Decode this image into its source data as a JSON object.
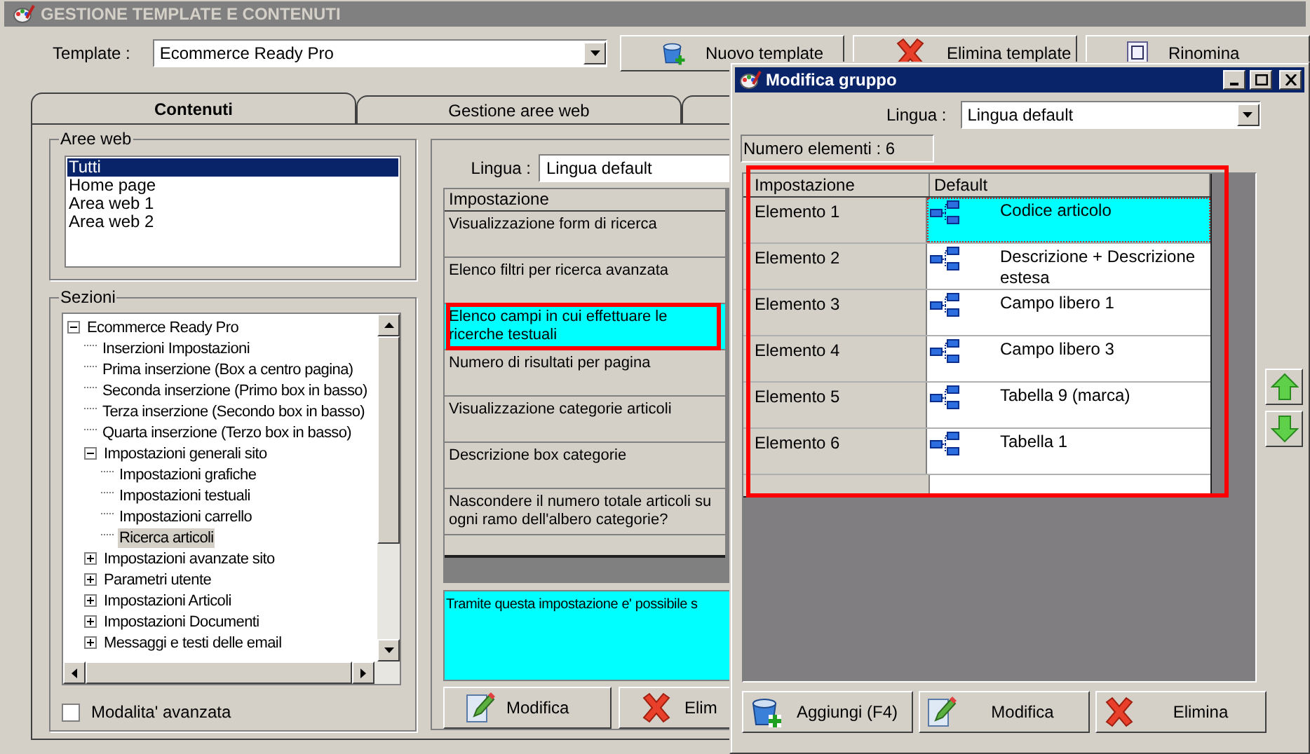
{
  "window": {
    "title": "GESTIONE TEMPLATE E CONTENUTI"
  },
  "template": {
    "label": "Template :",
    "value": "Ecommerce Ready Pro"
  },
  "toolbar": [
    {
      "label": "Nuovo template",
      "kind": "new"
    },
    {
      "label": "Elimina template",
      "kind": "delete"
    },
    {
      "label": "Rinomina",
      "kind": "rename"
    }
  ],
  "tabs": [
    {
      "label": "Contenuti",
      "selected": true
    },
    {
      "label": "Gestione aree web",
      "selected": false
    },
    {
      "selected": false
    }
  ],
  "aree_web": {
    "title": "Aree web",
    "items": [
      {
        "label": "Tutti",
        "selected": true
      },
      {
        "label": "Home page",
        "selected": false
      },
      {
        "label": "Area web 1",
        "selected": false
      },
      {
        "label": "Area web 2",
        "selected": false
      }
    ]
  },
  "sezioni": {
    "title": "Sezioni",
    "tree": [
      {
        "label": "Ecommerce Ready Pro",
        "selected": false,
        "expanded": true,
        "children": [
          {
            "label": "Inserzioni Impostazioni",
            "selected": false
          },
          {
            "label": "Prima inserzione (Box a centro pagina)",
            "selected": false
          },
          {
            "label": "Seconda inserzione (Primo box in basso)",
            "selected": false
          },
          {
            "label": "Terza inserzione (Secondo box in basso)",
            "selected": false
          },
          {
            "label": "Quarta inserzione (Terzo box in basso)",
            "selected": false
          },
          {
            "label": "Impostazioni generali sito",
            "selected": false,
            "expanded": true,
            "children": [
              {
                "label": "Impostazioni grafiche",
                "selected": false
              },
              {
                "label": "Impostazioni testuali",
                "selected": false
              },
              {
                "label": "Impostazioni carrello",
                "selected": false
              },
              {
                "label": "Ricerca articoli",
                "selected": true
              }
            ]
          },
          {
            "label": "Impostazioni avanzate sito",
            "selected": false,
            "expanded": false
          },
          {
            "label": "Parametri utente",
            "selected": false,
            "expanded": false
          },
          {
            "label": "Impostazioni Articoli",
            "selected": false,
            "expanded": false
          },
          {
            "label": "Impostazioni Documenti",
            "selected": false,
            "expanded": false
          },
          {
            "label": "Messaggi e testi delle email",
            "selected": false,
            "expanded": false
          }
        ]
      }
    ]
  },
  "advanced_mode": {
    "label": "Modalita' avanzata",
    "checked": false
  },
  "settings": {
    "lingua_label": "Lingua :",
    "lingua": "Lingua default",
    "column": "Impostazione",
    "rows": [
      {
        "label": "Visualizzazione form di ricerca",
        "selected": false,
        "highlighted": false
      },
      {
        "label": "Elenco filtri per ricerca avanzata",
        "selected": false,
        "highlighted": false
      },
      {
        "label": "Elenco campi in cui effettuare le ricerche testuali",
        "selected": true,
        "highlighted": true
      },
      {
        "label": "Numero di risultati per pagina",
        "selected": false,
        "highlighted": false
      },
      {
        "label": "Visualizzazione categorie articoli",
        "selected": false,
        "highlighted": false
      },
      {
        "label": "Descrizione box categorie",
        "selected": false,
        "highlighted": false
      },
      {
        "label": "Nascondere il numero totale articoli su ogni ramo dell'albero categorie?",
        "selected": false,
        "highlighted": false
      }
    ],
    "description": "Tramite questa impostazione e' possibile s",
    "buttons": [
      {
        "label": "Modifica",
        "kind": "edit"
      },
      {
        "label": "Elim",
        "kind": "delete"
      }
    ]
  },
  "dialog": {
    "title": "Modifica gruppo",
    "lingua_label": "Lingua :",
    "lingua": "Lingua default",
    "count": "Numero elementi : 6",
    "columns": [
      "Impostazione",
      "Default"
    ],
    "highlighted": true,
    "rows": [
      {
        "name": "Elemento 1",
        "value": "Codice articolo",
        "selected": true
      },
      {
        "name": "Elemento 2",
        "value": "Descrizione + Descrizione estesa",
        "selected": false
      },
      {
        "name": "Elemento 3",
        "value": "Campo libero 1",
        "selected": false
      },
      {
        "name": "Elemento 4",
        "value": "Campo libero 3",
        "selected": false
      },
      {
        "name": "Elemento 5",
        "value": "Tabella 9 (marca)",
        "selected": false
      },
      {
        "name": "Elemento 6",
        "value": "Tabella 1",
        "selected": false
      }
    ],
    "buttons": [
      {
        "label": "Aggiungi (F4)",
        "kind": "add"
      },
      {
        "label": "Modifica",
        "kind": "edit"
      },
      {
        "label": "Elimina",
        "kind": "delete"
      }
    ]
  }
}
